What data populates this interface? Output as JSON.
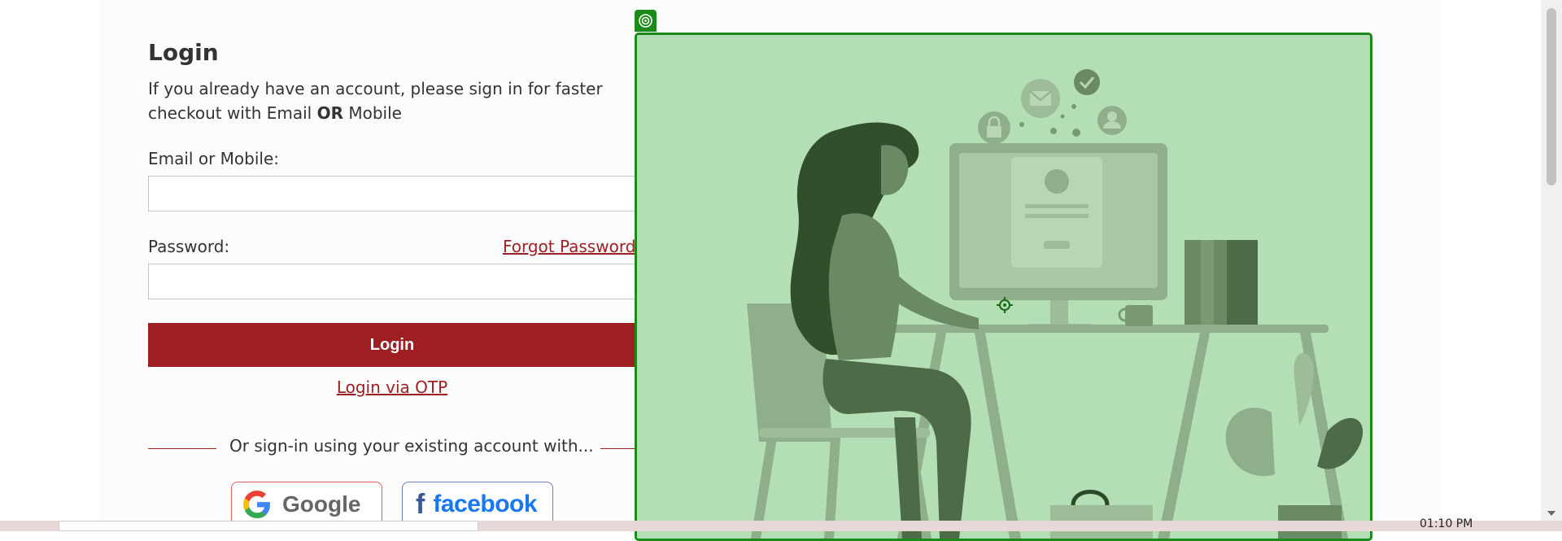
{
  "login": {
    "title": "Login",
    "intro_part1": "If you already have an account, please sign in for faster checkout with Email ",
    "intro_bold": "OR",
    "intro_part2": " Mobile",
    "email_label": "Email or Mobile:",
    "email_value": "",
    "password_label": "Password:",
    "password_value": "",
    "forgot_password": "Forgot Password?",
    "login_button": "Login",
    "otp_link": "Login via OTP",
    "divider_text": "Or sign-in using your existing account with...",
    "google_label": "Google",
    "facebook_label": "facebook"
  },
  "taskbar": {
    "clock": "01:10 PM"
  },
  "colors": {
    "brand": "#9e1f22",
    "overlay_border": "#1a8a1a",
    "overlay_fill": "#b4dfb4"
  },
  "icons": {
    "overlay_badge": "target-icon",
    "crosshair": "crosshair-icon",
    "google": "google-logo",
    "facebook": "facebook-logo"
  }
}
